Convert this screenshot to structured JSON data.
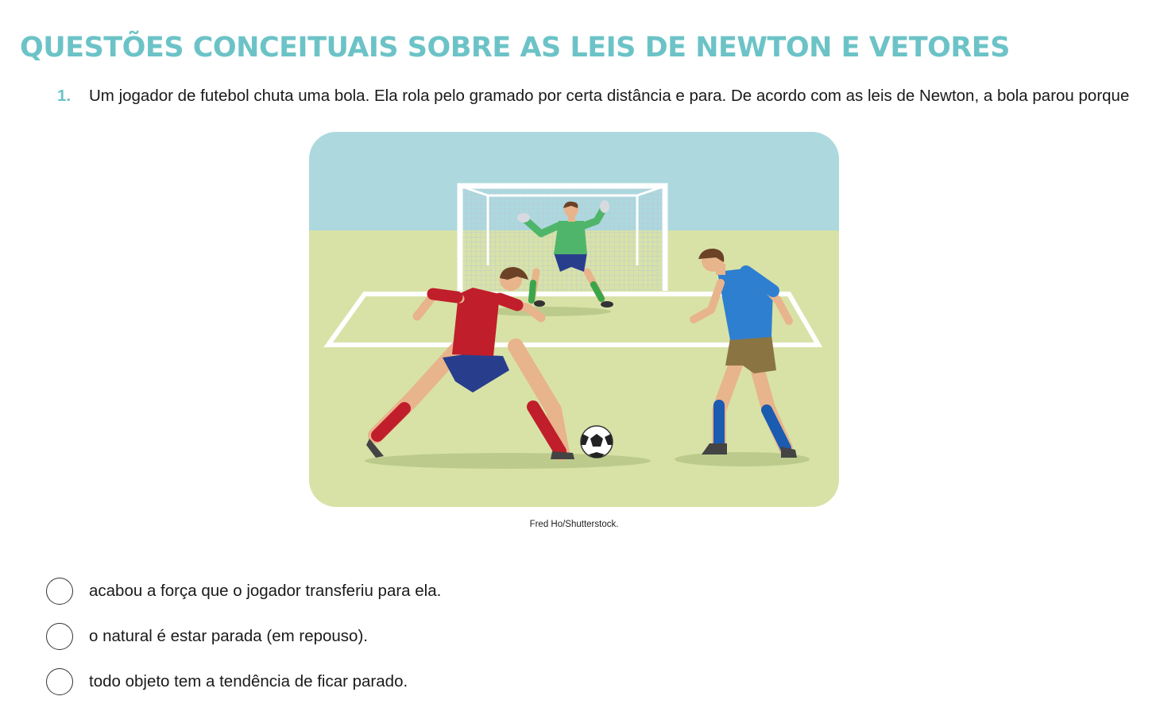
{
  "page_title": "QUESTÕES CONCEITUAIS SOBRE AS LEIS DE NEWTON E VETORES",
  "question": {
    "number": "1.",
    "text": "Um jogador de futebol chuta uma bola. Ela rola pelo gramado por certa distância e para. De acordo com as leis de Newton, a bola parou porque"
  },
  "figure": {
    "credit": "Fred Ho/Shutterstock."
  },
  "options": [
    {
      "text": "acabou a força que o jogador transferiu para ela.",
      "selected": false
    },
    {
      "text": "o natural é estar parada (em repouso).",
      "selected": false
    },
    {
      "text": "todo objeto tem a tendência de ficar parado.",
      "selected": false
    }
  ],
  "colors": {
    "accent": "#6cc3c7",
    "sky": "#acd8de",
    "grass": "#d8e2a7"
  }
}
